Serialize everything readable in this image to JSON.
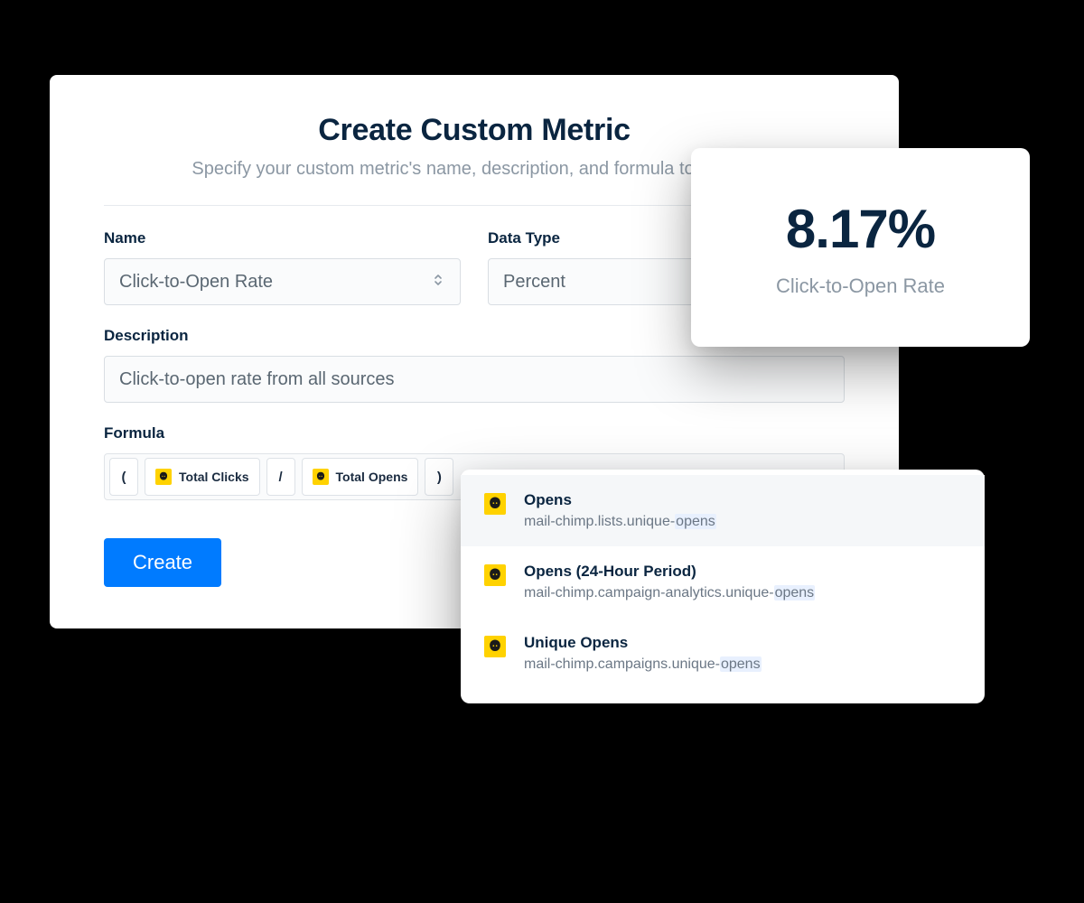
{
  "header": {
    "title": "Create Custom Metric",
    "subtitle": "Specify your custom metric's name, description, and formula to include"
  },
  "form": {
    "name_label": "Name",
    "name_value": "Click-to-Open Rate",
    "datatype_label": "Data Type",
    "datatype_value": "Percent",
    "description_label": "Description",
    "description_value": "Click-to-open rate from all sources",
    "formula_label": "Formula",
    "formula_tokens": {
      "open_paren": "(",
      "total_clicks": "Total Clicks",
      "slash": "/",
      "total_opens": "Total Opens",
      "close_paren": ")"
    },
    "create_button": "Create"
  },
  "stat": {
    "value": "8.17%",
    "label": "Click-to-Open Rate"
  },
  "suggestions": [
    {
      "title": "Opens",
      "subtitle_prefix": "mail-chimp.lists.unique-",
      "subtitle_highlight": "opens",
      "highlighted_row": true
    },
    {
      "title": "Opens (24-Hour Period)",
      "subtitle_prefix": "mail-chimp.campaign-analytics.unique-",
      "subtitle_highlight": "opens",
      "highlighted_row": false
    },
    {
      "title": "Unique Opens",
      "subtitle_prefix": "mail-chimp.campaigns.unique-",
      "subtitle_highlight": "opens",
      "highlighted_row": false
    }
  ],
  "icons": {
    "mailchimp": "mailchimp-icon",
    "stepper": "stepper-icon"
  }
}
